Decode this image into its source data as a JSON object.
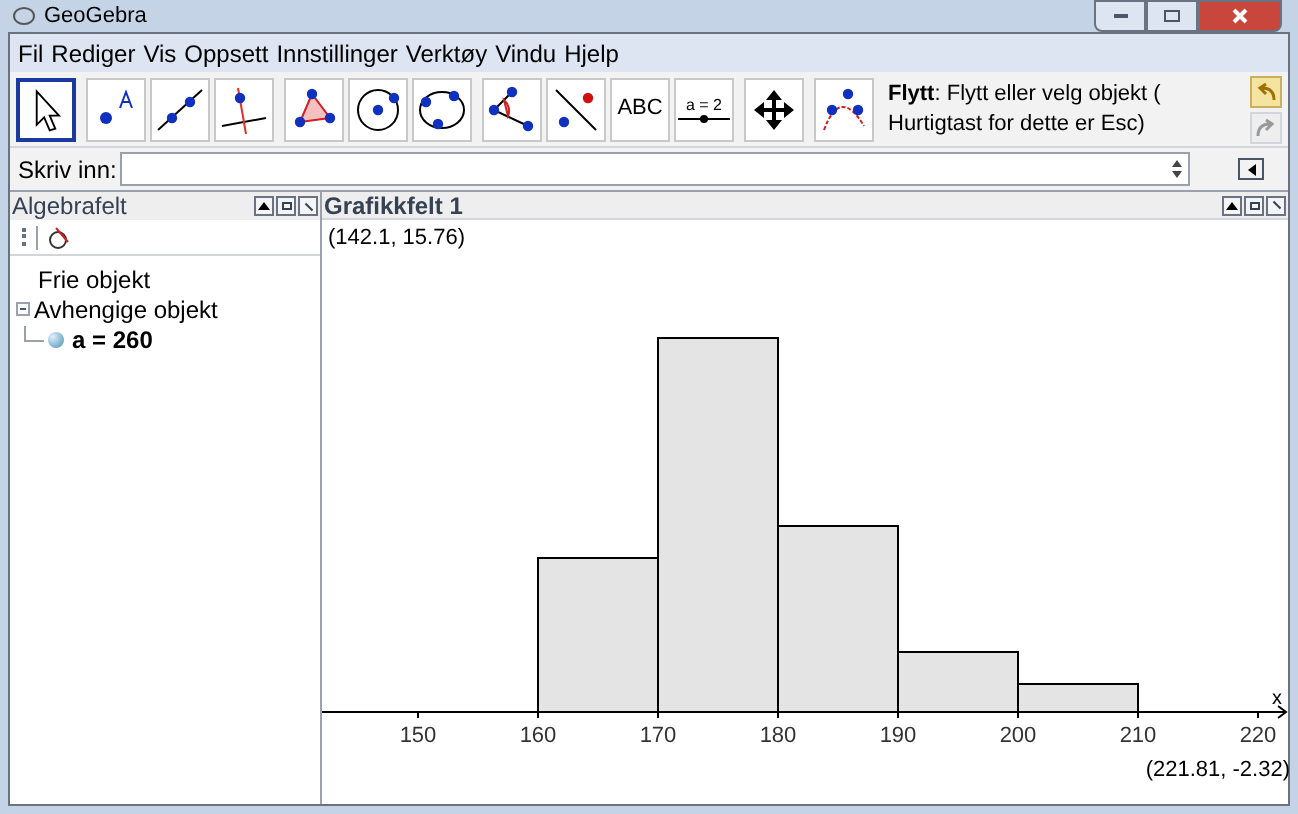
{
  "window": {
    "title": "GeoGebra"
  },
  "menu": [
    "Fil",
    "Rediger",
    "Vis",
    "Oppsett",
    "Innstillinger",
    "Verktøy",
    "Vindu",
    "Hjelp"
  ],
  "toolbar": {
    "groups": [
      [
        {
          "kind": "move",
          "selected": true
        }
      ],
      [
        {
          "kind": "point",
          "selected": false
        },
        {
          "kind": "line",
          "selected": false
        },
        {
          "kind": "perpendicular",
          "selected": false
        }
      ],
      [
        {
          "kind": "polygon",
          "selected": false
        },
        {
          "kind": "circle",
          "selected": false
        },
        {
          "kind": "conic",
          "selected": false
        }
      ],
      [
        {
          "kind": "angle",
          "selected": false
        },
        {
          "kind": "reflect",
          "selected": false
        },
        {
          "kind": "text",
          "label": "ABC",
          "selected": false
        },
        {
          "kind": "slider",
          "label": "a = 2",
          "selected": false
        }
      ],
      [
        {
          "kind": "pan",
          "selected": false
        }
      ],
      [
        {
          "kind": "locus",
          "selected": false
        }
      ]
    ],
    "help": "**Flytt**: Flytt eller velg objekt ( Hurtigtast for dette er Esc)"
  },
  "input_bar": {
    "label": "Skriv inn:"
  },
  "algebra": {
    "title": "Algebrafelt",
    "items": [
      {
        "label": "Frie objekt"
      },
      {
        "label": "Avhengige objekt",
        "expanded": true,
        "children": [
          {
            "label": "a = 260"
          }
        ]
      }
    ]
  },
  "graphics": {
    "title": "Grafikkfelt 1",
    "top_coords": "(142.1, 15.76)",
    "bottom_coords": "(221.81, -2.32)",
    "axis_label": "x",
    "xticks": [
      "150",
      "160",
      "170",
      "180",
      "190",
      "200",
      "210",
      "220"
    ]
  }
}
